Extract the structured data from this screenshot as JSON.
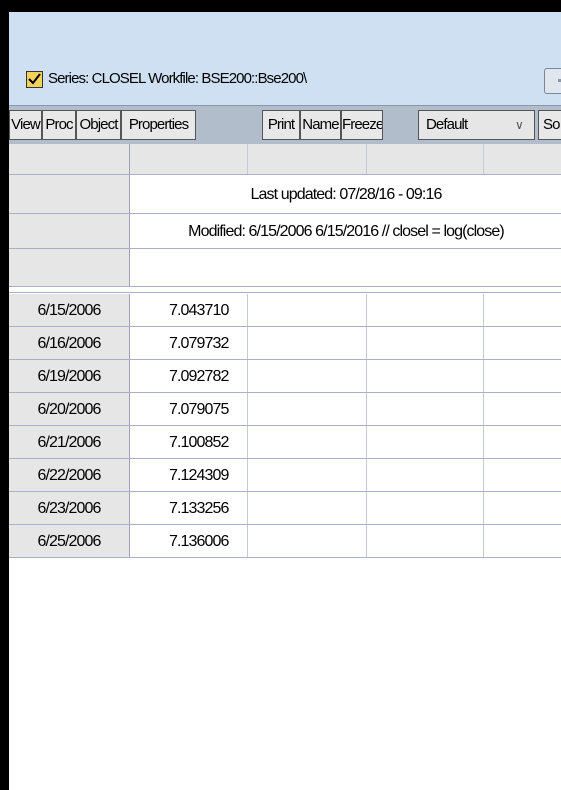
{
  "window": {
    "title": "Series: CLOSEL   Workfile: BSE200::Bse200\\"
  },
  "toolbar": {
    "buttons": [
      "View",
      "Proc",
      "Object",
      "Properties",
      "Print",
      "Name",
      "Freeze",
      "So"
    ],
    "display_select": "Default",
    "display_select_arrow": "∨"
  },
  "grid": {
    "last_updated": "Last updated: 07/28/16 - 09:16",
    "modified": "Modified: 6/15/2006 6/15/2016 // closel = log(close)",
    "rows": [
      {
        "date": "6/15/2006",
        "value": "7.043710"
      },
      {
        "date": "6/16/2006",
        "value": "7.079732"
      },
      {
        "date": "6/19/2006",
        "value": "7.092782"
      },
      {
        "date": "6/20/2006",
        "value": "7.079075"
      },
      {
        "date": "6/21/2006",
        "value": "7.100852"
      },
      {
        "date": "6/22/2006",
        "value": "7.124309"
      },
      {
        "date": "6/23/2006",
        "value": "7.133256"
      },
      {
        "date": "6/25/2006",
        "value": "7.136006"
      }
    ]
  },
  "colors": {
    "titlebar": "#cfe0f3",
    "toolbar": "#b2bdcc",
    "header_cell": "#e6e6e6",
    "grid_line": "#a9b0c8"
  }
}
